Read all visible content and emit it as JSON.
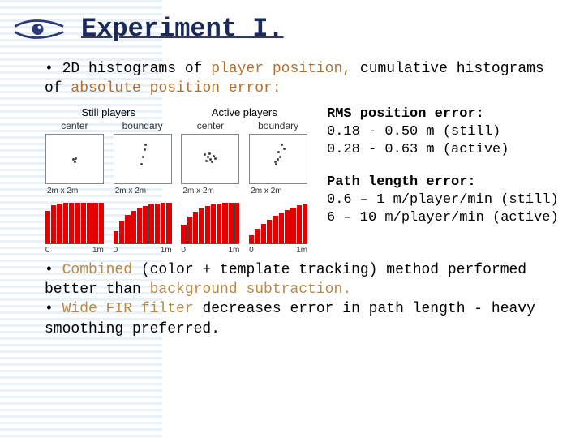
{
  "header": {
    "title": "Experiment I."
  },
  "bullet1": {
    "prefix": "• 2D histograms of",
    "hl_a": "player position,",
    "mid": " cumulative histograms of",
    "hl_b": "absolute position error:",
    "suffix": ""
  },
  "chart_data": [
    {
      "type": "scatter",
      "group": "Still players",
      "sub": "center",
      "axis": "2m x 2m",
      "points": [
        [
          0.48,
          0.5
        ],
        [
          0.52,
          0.48
        ],
        [
          0.5,
          0.54
        ]
      ]
    },
    {
      "type": "scatter",
      "group": "Still players",
      "sub": "boundary",
      "axis": "2m x 2m",
      "points": [
        [
          0.55,
          0.2
        ],
        [
          0.53,
          0.3
        ],
        [
          0.5,
          0.45
        ],
        [
          0.48,
          0.6
        ]
      ]
    },
    {
      "type": "scatter",
      "group": "Active players",
      "sub": "center",
      "axis": "2m x 2m",
      "points": [
        [
          0.4,
          0.4
        ],
        [
          0.45,
          0.45
        ],
        [
          0.5,
          0.5
        ],
        [
          0.55,
          0.42
        ],
        [
          0.52,
          0.55
        ],
        [
          0.48,
          0.38
        ],
        [
          0.58,
          0.48
        ],
        [
          0.42,
          0.52
        ]
      ]
    },
    {
      "type": "scatter",
      "group": "Active players",
      "sub": "boundary",
      "axis": "2m x 2m",
      "points": [
        [
          0.55,
          0.2
        ],
        [
          0.5,
          0.35
        ],
        [
          0.48,
          0.5
        ],
        [
          0.46,
          0.6
        ],
        [
          0.6,
          0.28
        ],
        [
          0.52,
          0.45
        ],
        [
          0.44,
          0.55
        ]
      ]
    },
    {
      "type": "bar",
      "group": "Still players",
      "sub": "center",
      "xlabel0": "0",
      "xlabel1": "1m",
      "values": [
        0.8,
        0.93,
        0.97,
        0.99,
        1.0,
        1.0,
        1.0,
        1.0,
        1.0,
        1.0
      ],
      "ylim": [
        0,
        1
      ]
    },
    {
      "type": "bar",
      "group": "Still players",
      "sub": "boundary",
      "xlabel0": "0",
      "xlabel1": "1m",
      "values": [
        0.3,
        0.55,
        0.7,
        0.8,
        0.87,
        0.92,
        0.96,
        0.98,
        0.99,
        1.0
      ],
      "ylim": [
        0,
        1
      ]
    },
    {
      "type": "bar",
      "group": "Active players",
      "sub": "center",
      "xlabel0": "0",
      "xlabel1": "1m",
      "values": [
        0.45,
        0.65,
        0.78,
        0.86,
        0.91,
        0.95,
        0.97,
        0.99,
        1.0,
        1.0
      ],
      "ylim": [
        0,
        1
      ]
    },
    {
      "type": "bar",
      "group": "Active players",
      "sub": "boundary",
      "xlabel0": "0",
      "xlabel1": "1m",
      "values": [
        0.2,
        0.35,
        0.48,
        0.58,
        0.67,
        0.75,
        0.82,
        0.88,
        0.93,
        0.97
      ],
      "ylim": [
        0,
        1
      ]
    }
  ],
  "stats": {
    "rms": {
      "hdr": "RMS position error:",
      "l1": "0.18 - 0.50 m (still)",
      "l2": "0.28 - 0.63 m (active)"
    },
    "path": {
      "hdr": "Path length error:",
      "l1": "0.6 – 1 m/player/min (still)",
      "l2": "6 – 10 m/player/min (active)"
    }
  },
  "bullet2": {
    "p1a": "• ",
    "p1hl": "Combined",
    "p1b": " (color + template tracking) method performed better than",
    "p1hl2": " background subtraction.",
    "p2a": "• ",
    "p2hl": "Wide FIR filter",
    "p2b": " decreases error in path length - heavy smoothing preferred."
  }
}
